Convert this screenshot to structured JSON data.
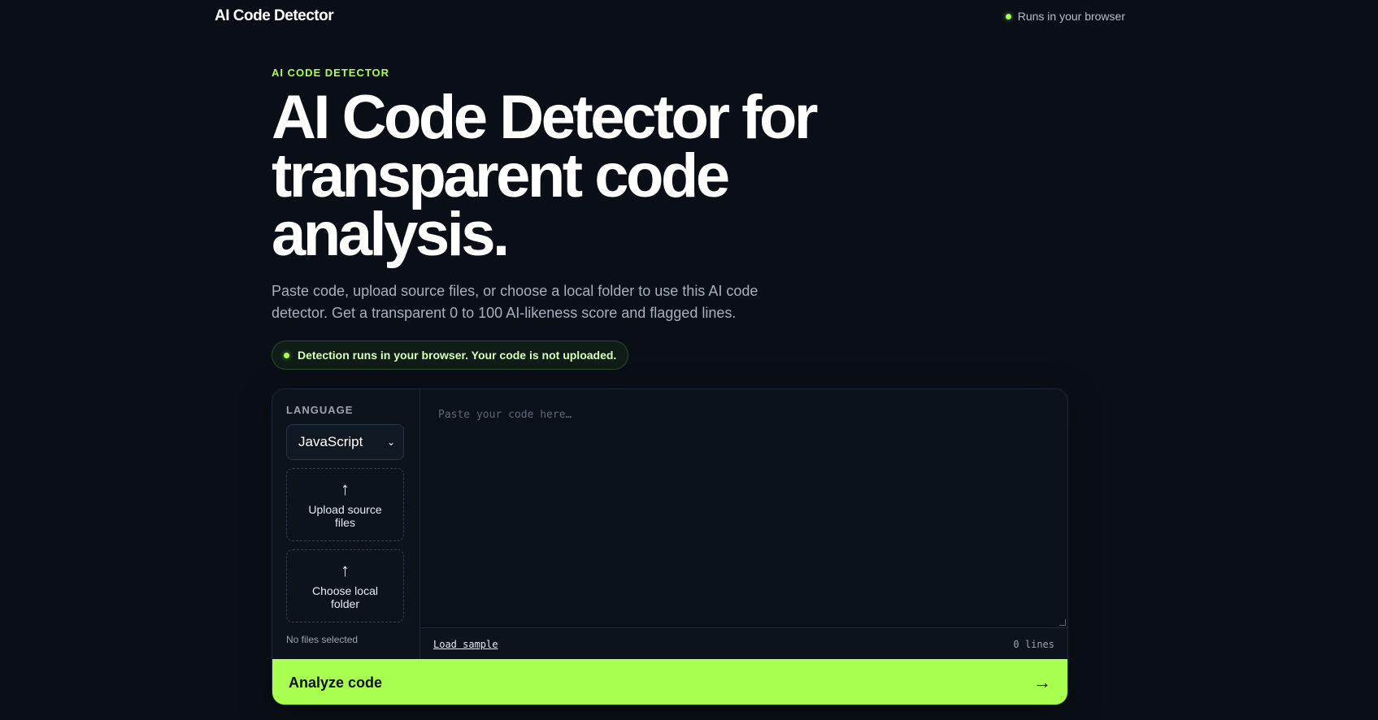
{
  "header": {
    "brand": "AI Code Detector",
    "status": "Runs in your browser"
  },
  "hero": {
    "eyebrow": "AI CODE DETECTOR",
    "headline": "AI Code Detector for transparent code analysis.",
    "subtitle": "Paste code, upload source files, or choose a local folder to use this AI code detector. Get a transparent 0 to 100 AI-likeness score and flagged lines.",
    "privacy_pill": "Detection runs in your browser. Your code is not uploaded."
  },
  "panel": {
    "language_label": "LANGUAGE",
    "language_value": "JavaScript",
    "upload_files_label": "Upload source files",
    "choose_folder_label": "Choose local folder",
    "upload_arrow": "↑",
    "no_files": "No files selected",
    "editor_placeholder": "Paste your code here…",
    "load_sample": "Load sample",
    "line_count": "0 lines",
    "analyze_label": "Analyze code",
    "analyze_arrow": "→"
  },
  "colors": {
    "accent": "#a8ff4f",
    "background": "#0a0f17"
  }
}
